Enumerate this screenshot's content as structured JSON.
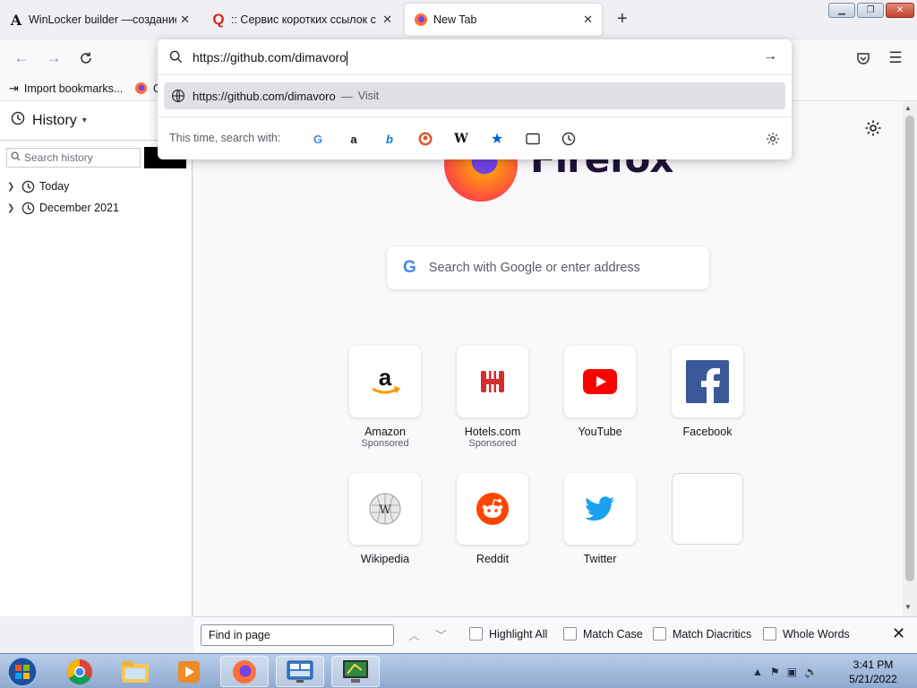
{
  "tabs": [
    {
      "title": "WinLocker builder —создание",
      "favicon": "A",
      "close": "✕"
    },
    {
      "title": ":: Сервис коротких ссылок с о",
      "favicon": "Q",
      "close": "✕"
    },
    {
      "title": "New Tab",
      "favicon": "firefox-icon",
      "close": "✕"
    }
  ],
  "new_tab_glyph": "+",
  "bookmarks": {
    "import_label": "Import bookmarks...",
    "next_item_label": "G"
  },
  "sidebar": {
    "title": "History",
    "search_placeholder": "Search history",
    "items": [
      {
        "label": "Today"
      },
      {
        "label": "December 2021"
      }
    ]
  },
  "url_panel": {
    "typed_value": "https://github.com/dimavoro",
    "suggestion_url": "https://github.com/dimavoro",
    "suggestion_action": "Visit",
    "suggestion_dash": "—",
    "oneoff_label": "This time, search with:"
  },
  "newtab": {
    "brand_word": "Firefox",
    "search_placeholder": "Search with Google or enter address",
    "tiles": [
      {
        "label": "Amazon",
        "sponsored": "Sponsored"
      },
      {
        "label": "Hotels.com",
        "sponsored": "Sponsored"
      },
      {
        "label": "YouTube",
        "sponsored": ""
      },
      {
        "label": "Facebook",
        "sponsored": ""
      },
      {
        "label": "Wikipedia",
        "sponsored": ""
      },
      {
        "label": "Reddit",
        "sponsored": ""
      },
      {
        "label": "Twitter",
        "sponsored": ""
      }
    ]
  },
  "findbar": {
    "placeholder": "Find in page",
    "options": [
      {
        "label": "Highlight All"
      },
      {
        "label": "Match Case"
      },
      {
        "label": "Match Diacritics"
      },
      {
        "label": "Whole Words"
      }
    ]
  },
  "taskbar": {
    "time": "3:41 PM",
    "date": "5/21/2022"
  },
  "colors": {
    "firefox_purple": "#7542e5",
    "firefox_orange": "#ff980e",
    "youtube_red": "#ff0000",
    "facebook_blue": "#3b5998",
    "reddit_orange": "#ff4500",
    "twitter_blue": "#1da1f2",
    "hotels_red": "#d32f2f"
  }
}
